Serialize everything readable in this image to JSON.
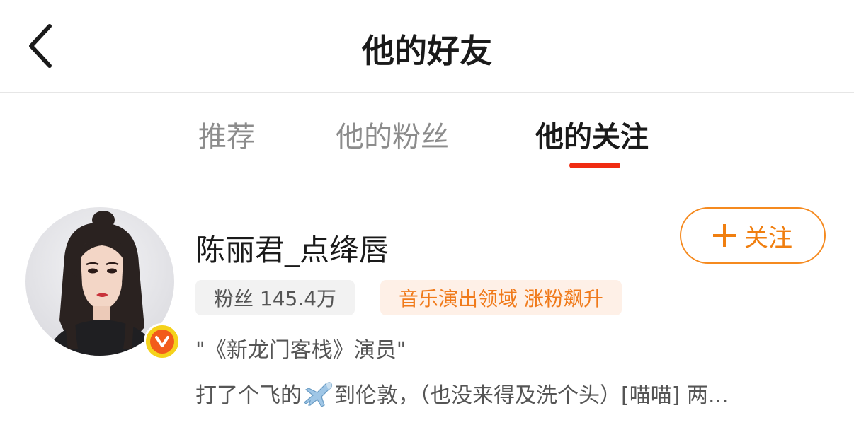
{
  "header": {
    "title": "他的好友",
    "back_icon": "chevron-left-icon"
  },
  "tabs": [
    {
      "label": "推荐",
      "active": false
    },
    {
      "label": "他的粉丝",
      "active": false
    },
    {
      "label": "他的关注",
      "active": true
    }
  ],
  "colors": {
    "accent": "#f02c12",
    "follow": "#f07f10",
    "verified": "#f5d21b"
  },
  "user": {
    "name": "陈丽君_点绛唇",
    "follow_label": "关注",
    "fans_badge": "粉丝 145.4万",
    "domain_badge": "音乐演出领域 涨粉飙升",
    "description": "\"《新龙门客栈》演员\"",
    "post_before_icon": "打了个飞的",
    "post_icon": "airplane-icon",
    "post_after_icon": "到伦敦，（也没来得及洗个头）[喵喵] 两..."
  }
}
